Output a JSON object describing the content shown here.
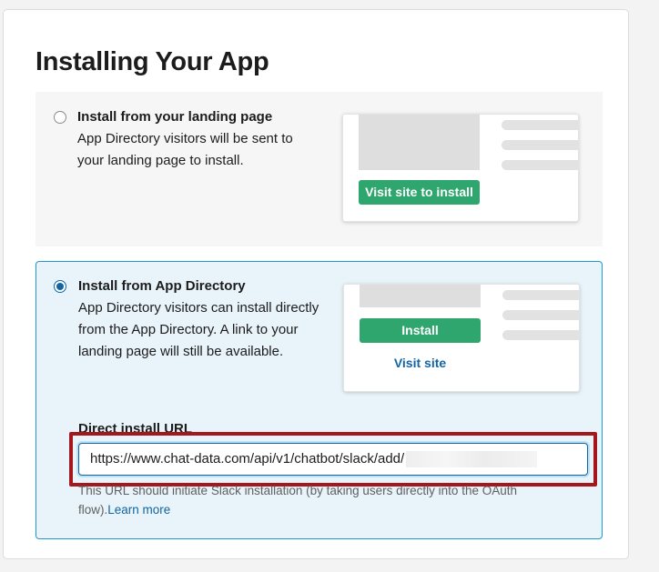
{
  "page": {
    "title": "Installing Your App"
  },
  "options": {
    "landing": {
      "heading": "Install from your landing page",
      "description": "App Directory visitors will be sent to your landing page to install.",
      "selected": false,
      "preview_button": "Visit site to install"
    },
    "directory": {
      "heading": "Install from App Directory",
      "description": "App Directory visitors can install directly from the App Directory. A link to your landing page will still be available.",
      "selected": true,
      "preview_install_button": "Install",
      "preview_visit_link": "Visit site"
    }
  },
  "direct_install": {
    "label": "Direct install URL",
    "value": "https://www.chat-data.com/api/v1/chatbot/slack/add/",
    "help_text": "This URL should initiate Slack installation (by taking users directly into the OAuth flow).",
    "learn_more": "Learn more"
  },
  "colors": {
    "accent_blue": "#1264a3",
    "button_green": "#2ea66e",
    "highlight_red": "#a4181d",
    "selected_bg": "#e8f4fa"
  }
}
